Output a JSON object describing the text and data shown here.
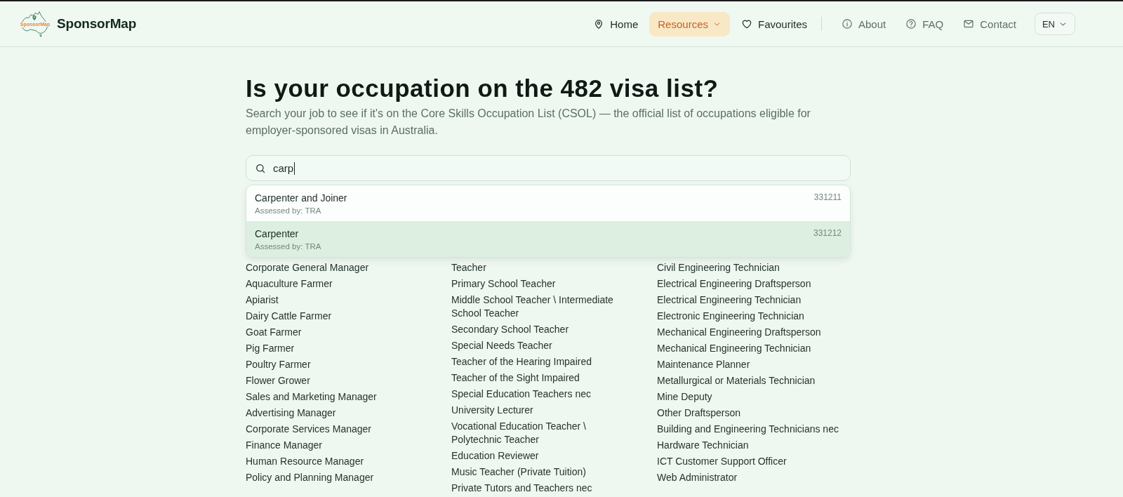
{
  "header": {
    "logo": {
      "badge_text": "SponsorMap"
    },
    "brand": "SponsorMap",
    "nav": [
      {
        "label": "Home",
        "kind": "link",
        "selected": false
      },
      {
        "label": "Resources",
        "kind": "menu",
        "selected": true
      },
      {
        "label": "Favourites",
        "kind": "link",
        "selected": false
      }
    ],
    "secondary_nav": [
      {
        "label": "About"
      },
      {
        "label": "FAQ"
      },
      {
        "label": "Contact"
      }
    ],
    "language": {
      "label": "EN"
    }
  },
  "main": {
    "heading": "Is your occupation on the 482 visa list?",
    "intro": "Search your job to see if it's on the Core Skills Occupation List (CSOL) — the official list of occupations eligible for employer-sponsored visas in Australia.",
    "search": {
      "value": "carp"
    },
    "suggestions": [
      {
        "name": "Carpenter and Joiner",
        "assessed_by": "Assessed by: TRA",
        "code": "331211",
        "selected": false
      },
      {
        "name": "Carpenter",
        "assessed_by": "Assessed by: TRA",
        "code": "331212",
        "selected": true
      }
    ],
    "occupation_columns": [
      [
        "Corporate General Manager",
        "Aquaculture Farmer",
        "Apiarist",
        "Dairy Cattle Farmer",
        "Goat Farmer",
        "Pig Farmer",
        "Poultry Farmer",
        "Flower Grower",
        "Sales and Marketing Manager",
        "Advertising Manager",
        "Corporate Services Manager",
        "Finance Manager",
        "Human Resource Manager",
        "Policy and Planning Manager"
      ],
      [
        "Teacher",
        "Primary School Teacher",
        "Middle School Teacher \\ Intermediate School Teacher",
        "Secondary School Teacher",
        "Special Needs Teacher",
        "Teacher of the Hearing Impaired",
        "Teacher of the Sight Impaired",
        "Special Education Teachers nec",
        "University Lecturer",
        "Vocational Education Teacher \\ Polytechnic Teacher",
        "Education Reviewer",
        "Music Teacher (Private Tuition)",
        "Private Tutors and Teachers nec"
      ],
      [
        "Civil Engineering Technician",
        "Electrical Engineering Draftsperson",
        "Electrical Engineering Technician",
        "Electronic Engineering Technician",
        "Mechanical Engineering Draftsperson",
        "Mechanical Engineering Technician",
        "Maintenance Planner",
        "Metallurgical or Materials Technician",
        "Mine Deputy",
        "Other Draftsperson",
        "Building and Engineering Technicians nec",
        "Hardware Technician",
        "ICT Customer Support Officer",
        "Web Administrator"
      ]
    ]
  }
}
